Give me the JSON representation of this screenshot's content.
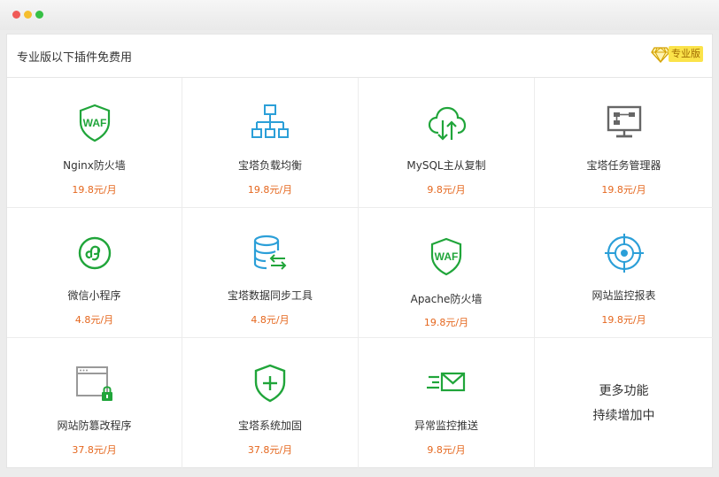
{
  "header": {
    "title": "专业版以下插件免费用",
    "badge_label": "专业版",
    "badge_icon": "diamond-icon"
  },
  "colors": {
    "green": "#20a53a",
    "blue": "#2b9fd8",
    "gray": "#666666",
    "price": "#e5671e",
    "badge": "#fbe34a"
  },
  "plugins": [
    {
      "name": "Nginx防火墙",
      "price": "19.8元/月",
      "icon": "waf-shield-icon"
    },
    {
      "name": "宝塔负载均衡",
      "price": "19.8元/月",
      "icon": "network-tree-icon"
    },
    {
      "name": "MySQL主从复制",
      "price": "9.8元/月",
      "icon": "cloud-sync-icon"
    },
    {
      "name": "宝塔任务管理器",
      "price": "19.8元/月",
      "icon": "monitor-icon"
    },
    {
      "name": "微信小程序",
      "price": "4.8元/月",
      "icon": "mini-program-icon"
    },
    {
      "name": "宝塔数据同步工具",
      "price": "4.8元/月",
      "icon": "database-sync-icon"
    },
    {
      "name": "Apache防火墙",
      "price": "19.8元/月",
      "icon": "waf-shield-icon"
    },
    {
      "name": "网站监控报表",
      "price": "19.8元/月",
      "icon": "radar-icon"
    },
    {
      "name": "网站防篡改程序",
      "price": "37.8元/月",
      "icon": "locked-window-icon"
    },
    {
      "name": "宝塔系统加固",
      "price": "37.8元/月",
      "icon": "shield-plus-icon"
    },
    {
      "name": "异常监控推送",
      "price": "9.8元/月",
      "icon": "mail-send-icon"
    }
  ],
  "more": {
    "line1": "更多功能",
    "line2": "持续增加中"
  }
}
